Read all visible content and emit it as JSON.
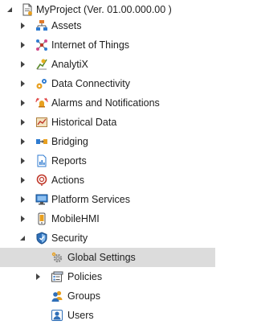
{
  "tree": {
    "root": {
      "label": "MyProject (Ver. 01.00.000.00 )",
      "expanded": true,
      "icon": "project-document-icon"
    },
    "items": [
      {
        "label": "Assets",
        "expanded": false,
        "icon": "assets-icon"
      },
      {
        "label": "Internet of Things",
        "expanded": false,
        "icon": "iot-icon"
      },
      {
        "label": "AnalytiX",
        "expanded": false,
        "icon": "analytix-icon"
      },
      {
        "label": "Data Connectivity",
        "expanded": false,
        "icon": "data-connectivity-icon"
      },
      {
        "label": "Alarms and Notifications",
        "expanded": false,
        "icon": "alarm-icon"
      },
      {
        "label": "Historical Data",
        "expanded": false,
        "icon": "historical-data-icon"
      },
      {
        "label": "Bridging",
        "expanded": false,
        "icon": "bridging-icon"
      },
      {
        "label": "Reports",
        "expanded": false,
        "icon": "reports-icon"
      },
      {
        "label": "Actions",
        "expanded": false,
        "icon": "actions-icon"
      },
      {
        "label": "Platform Services",
        "expanded": false,
        "icon": "platform-services-icon"
      },
      {
        "label": "MobileHMI",
        "expanded": false,
        "icon": "mobilehmi-icon"
      },
      {
        "label": "Security",
        "expanded": true,
        "icon": "security-shield-icon"
      }
    ],
    "security_children": [
      {
        "label": "Global Settings",
        "selected": true,
        "icon": "gear-icon"
      },
      {
        "label": "Policies",
        "expanded": false,
        "icon": "policies-icon"
      },
      {
        "label": "Groups",
        "icon": "groups-icon"
      },
      {
        "label": "Users",
        "icon": "users-icon"
      }
    ]
  },
  "colors": {
    "selection": "#dcdcdc",
    "arrow": "#444444",
    "text": "#1e1e1e"
  }
}
